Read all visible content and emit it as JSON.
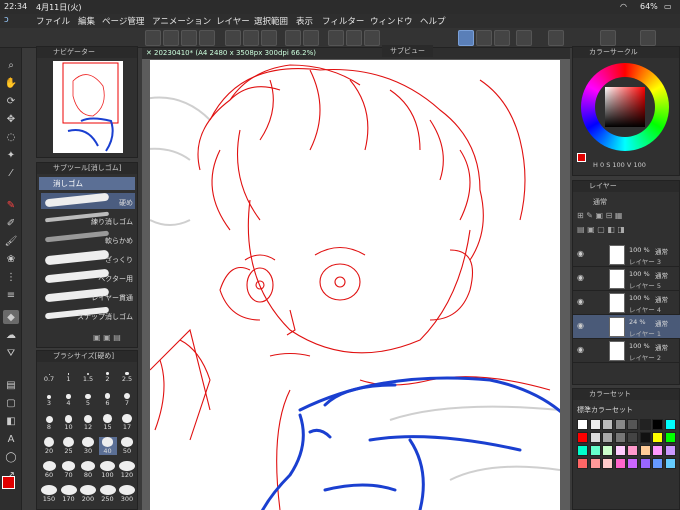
{
  "status": {
    "time": "22:34",
    "date": "4月11日(火)",
    "battery": "64%"
  },
  "menu": [
    "ファイル",
    "編集",
    "ページ管理",
    "アニメーション",
    "レイヤー",
    "選択範囲",
    "表示",
    "フィルター",
    "ウィンドウ",
    "ヘルプ"
  ],
  "document": {
    "tab_title": "20230410* (A4 2480 x 3508px 300dpi 66.2%)"
  },
  "subview": {
    "title": "サブビュー"
  },
  "navigator": {
    "title": "ナビゲーター"
  },
  "subtool": {
    "title": "サブツール[消しゴム]",
    "group": "消しゴム",
    "items": [
      "硬め",
      "練り消しゴム",
      "軟らかめ",
      "ざっくり",
      "ベクター用",
      "レイヤー貫通",
      "スナップ消しゴム"
    ]
  },
  "brushsize": {
    "title": "ブラシサイズ[硬め]",
    "sizes": [
      "0.7",
      "1",
      "1.5",
      "2",
      "2.5",
      "3",
      "4",
      "5",
      "6",
      "7",
      "8",
      "10",
      "12",
      "15",
      "17",
      "20",
      "25",
      "30",
      "40",
      "50",
      "60",
      "70",
      "80",
      "100",
      "120",
      "150",
      "170",
      "200",
      "250",
      "300"
    ],
    "selected": "40"
  },
  "colorwheel": {
    "title": "カラーサークル",
    "h": "0",
    "s": "100",
    "v": "100"
  },
  "layers": {
    "title": "レイヤー",
    "blend": "通常",
    "items": [
      {
        "pct": "100 %",
        "mode": "通常",
        "name": "レイヤー 3"
      },
      {
        "pct": "100 %",
        "mode": "通常",
        "name": "レイヤー 5"
      },
      {
        "pct": "100 %",
        "mode": "通常",
        "name": "レイヤー 4"
      },
      {
        "pct": "24 %",
        "mode": "通常",
        "name": "レイヤー 1"
      },
      {
        "pct": "100 %",
        "mode": "通常",
        "name": "レイヤー 2"
      }
    ]
  },
  "colorset": {
    "title": "カラーセット",
    "set_name": "標準カラーセット"
  },
  "colors": {
    "main": "#e00000",
    "sub": "#ffffff"
  }
}
